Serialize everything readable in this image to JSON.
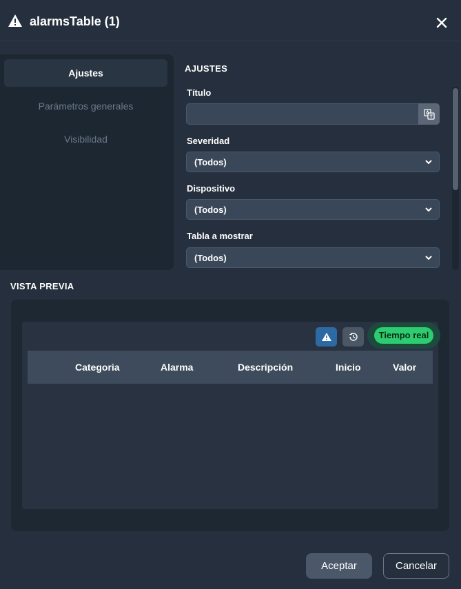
{
  "header": {
    "title": "alarmsTable (1)",
    "icon": "warning-triangle-icon",
    "close_icon": "close-icon"
  },
  "sidenav": {
    "items": [
      {
        "label": "Ajustes",
        "active": true
      },
      {
        "label": "Parámetros generales",
        "active": false
      },
      {
        "label": "Visibilidad",
        "active": false
      }
    ]
  },
  "settings": {
    "section_title": "AJUSTES",
    "title_label": "Título",
    "title_value": "",
    "severity_label": "Severidad",
    "severity_value": "(Todos)",
    "device_label": "Dispositivo",
    "device_value": "(Todos)",
    "table_label": "Tabla a mostrar",
    "table_value": "(Todos)"
  },
  "preview": {
    "section_title": "VISTA PREVIA",
    "realtime_label": "Tiempo real",
    "columns": [
      "Categoria",
      "Alarma",
      "Descripción",
      "Inicio",
      "Valor"
    ]
  },
  "footer": {
    "accept_label": "Aceptar",
    "cancel_label": "Cancelar"
  },
  "colors": {
    "background": "#252f3d",
    "accent_blue": "#2d6aa3",
    "realtime_green": "#2ecc71"
  }
}
